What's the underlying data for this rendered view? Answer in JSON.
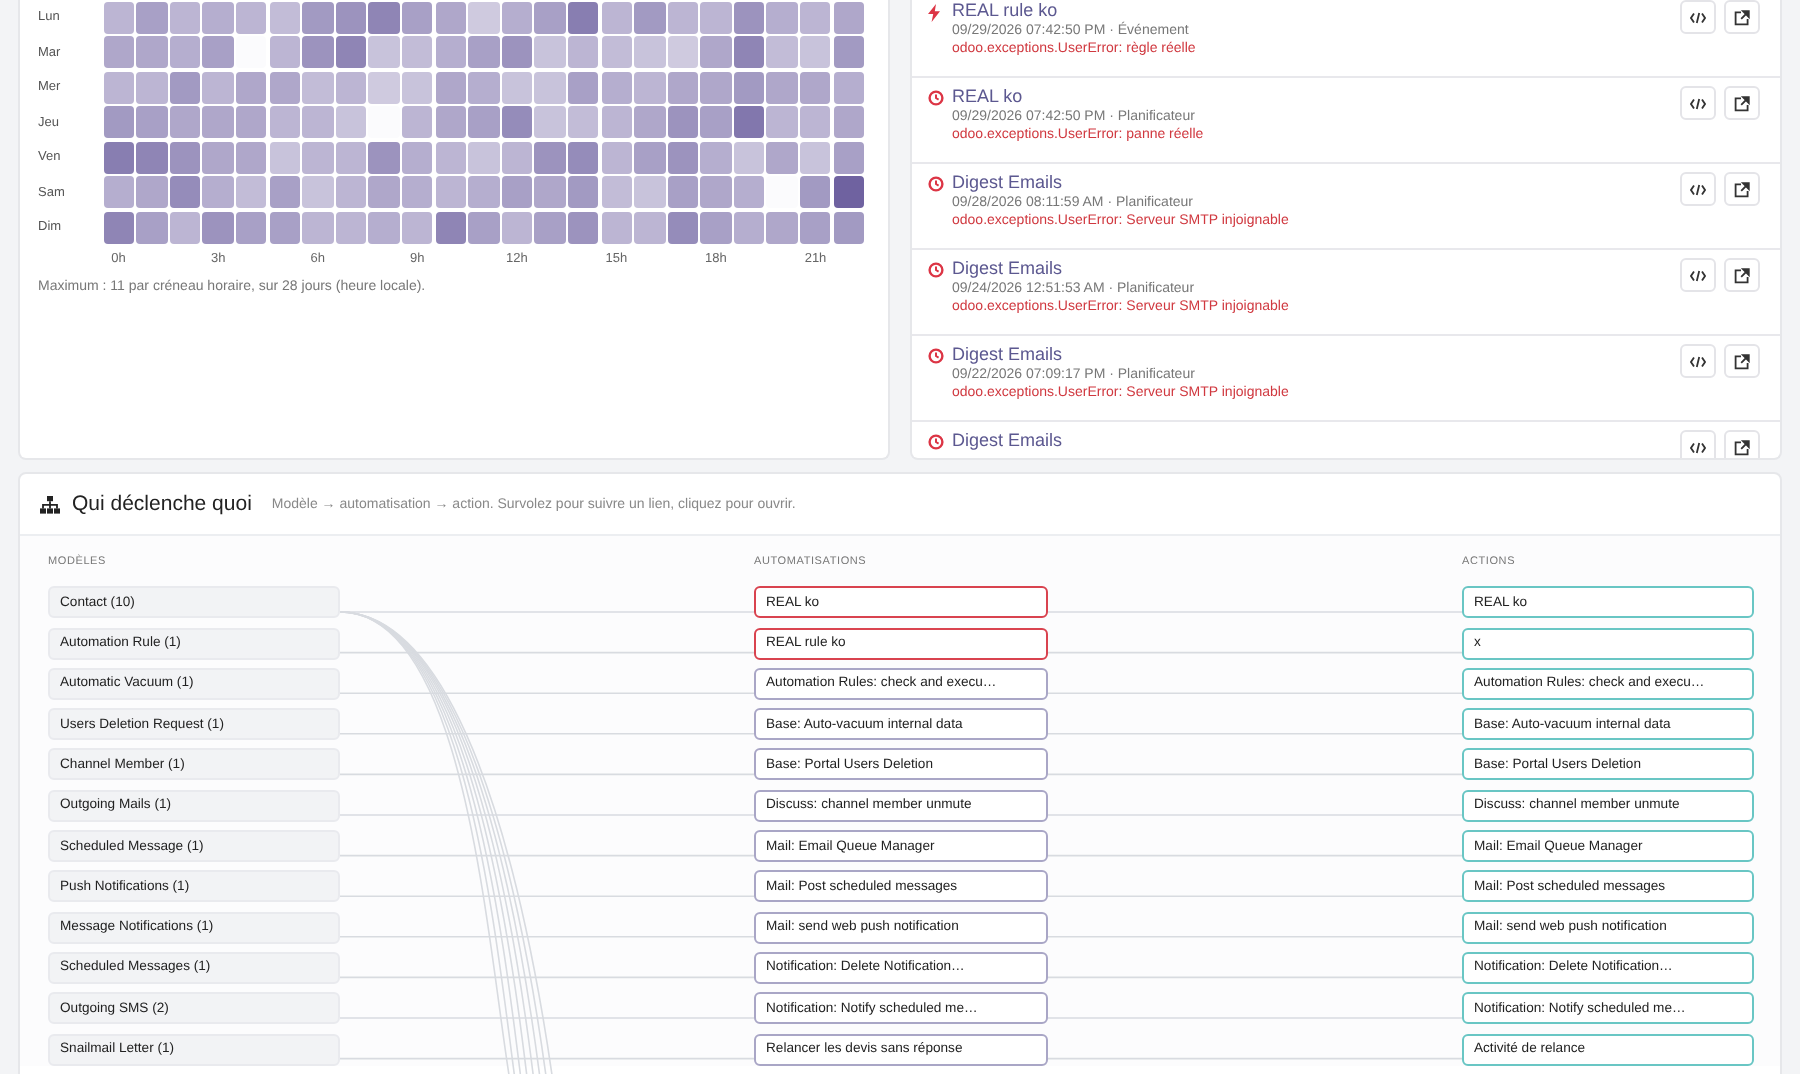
{
  "heatmap": {
    "days": [
      "Lun",
      "Mar",
      "Mer",
      "Jeu",
      "Ven",
      "Sam",
      "Dim"
    ],
    "hour_labels": [
      "0h",
      "3h",
      "6h",
      "9h",
      "12h",
      "15h",
      "18h",
      "21h"
    ],
    "note": "Maximum : 11 par créneau horaire, sur 28 jours (heure locale)."
  },
  "failures": [
    {
      "kind": "event",
      "title": "REAL rule ko",
      "meta": "09/29/2026 07:42:50 PM · Événement",
      "error": "odoo.exceptions.UserError: règle réelle"
    },
    {
      "kind": "scheduled",
      "title": "REAL ko",
      "meta": "09/29/2026 07:42:50 PM · Planificateur",
      "error": "odoo.exceptions.UserError: panne réelle"
    },
    {
      "kind": "scheduled",
      "title": "Digest Emails",
      "meta": "09/28/2026 08:11:59 AM · Planificateur",
      "error": "odoo.exceptions.UserError: Serveur SMTP injoignable"
    },
    {
      "kind": "scheduled",
      "title": "Digest Emails",
      "meta": "09/24/2026 12:51:53 AM · Planificateur",
      "error": "odoo.exceptions.UserError: Serveur SMTP injoignable"
    },
    {
      "kind": "scheduled",
      "title": "Digest Emails",
      "meta": "09/22/2026 07:09:17 PM · Planificateur",
      "error": "odoo.exceptions.UserError: Serveur SMTP injoignable"
    },
    {
      "kind": "scheduled",
      "title": "Digest Emails"
    }
  ],
  "flow": {
    "title": "Qui déclenche quoi",
    "subtitle": "Modèle → automatisation → action. Survolez pour suivre un lien, cliquez pour ouvrir.",
    "columns": [
      "MODÈLES",
      "AUTOMATISATIONS",
      "ACTIONS"
    ],
    "models": [
      "Contact (10)",
      "Automation Rule (1)",
      "Automatic Vacuum (1)",
      "Users Deletion Request (1)",
      "Channel Member (1)",
      "Outgoing Mails (1)",
      "Scheduled Message (1)",
      "Push Notifications (1)",
      "Message Notifications (1)",
      "Scheduled Messages (1)",
      "Outgoing SMS (2)",
      "Snailmail Letter (1)"
    ],
    "automations": [
      {
        "label": "REAL ko",
        "failing": true
      },
      {
        "label": "REAL rule ko",
        "failing": true
      },
      {
        "label": "Automation Rules: check and execu…",
        "failing": false
      },
      {
        "label": "Base: Auto-vacuum internal data",
        "failing": false
      },
      {
        "label": "Base: Portal Users Deletion",
        "failing": false
      },
      {
        "label": "Discuss: channel member unmute",
        "failing": false
      },
      {
        "label": "Mail: Email Queue Manager",
        "failing": false
      },
      {
        "label": "Mail: Post scheduled messages",
        "failing": false
      },
      {
        "label": "Mail: send web push notification",
        "failing": false
      },
      {
        "label": "Notification: Delete Notification…",
        "failing": false
      },
      {
        "label": "Notification: Notify scheduled me…",
        "failing": false
      },
      {
        "label": "Relancer les devis sans réponse",
        "failing": false
      }
    ],
    "actions": [
      "REAL ko",
      "x",
      "Automation Rules: check and execu…",
      "Base: Auto-vacuum internal data",
      "Base: Portal Users Deletion",
      "Discuss: channel member unmute",
      "Mail: Email Queue Manager",
      "Mail: Post scheduled messages",
      "Mail: send web push notification",
      "Notification: Delete Notification…",
      "Notification: Notify scheduled me…",
      "Activité de relance"
    ]
  }
}
